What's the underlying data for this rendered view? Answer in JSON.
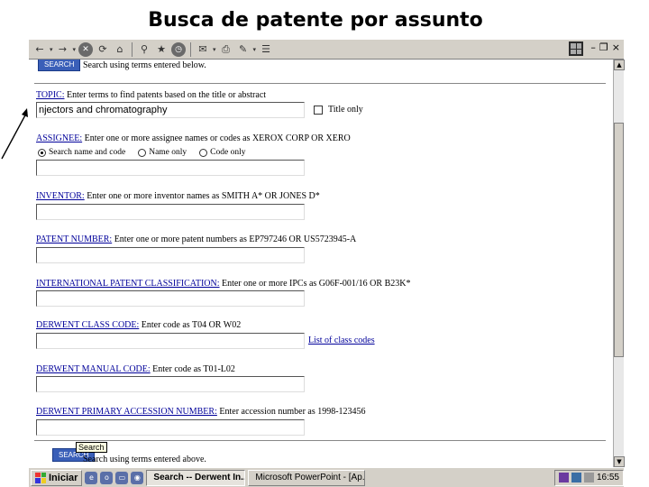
{
  "slide": {
    "title": "Busca de patente por assunto"
  },
  "browser": {
    "toolbar_icons": [
      "back-arrow-icon",
      "forward-arrow-icon",
      "stop-icon",
      "refresh-icon",
      "home-icon",
      "search-icon",
      "favorites-icon",
      "history-icon",
      "mail-icon",
      "print-icon",
      "edit-icon",
      "discuss-icon"
    ],
    "window_controls": {
      "minimize": "–",
      "restore": "❐",
      "close": "×"
    }
  },
  "form": {
    "top_search_button": "SEARCH",
    "top_search_note": "Search using terms entered below.",
    "topic": {
      "label": "TOPIC:",
      "hint": " Enter terms to find patents based on the title or abstract",
      "value": "njectors and chromatography",
      "title_only_label": "Title only"
    },
    "assignee": {
      "label": "ASSIGNEE:",
      "hint": " Enter one or more assignee names or codes as XEROX CORP OR XERO",
      "radios": [
        {
          "label": "Search name and code",
          "checked": true
        },
        {
          "label": "Name only",
          "checked": false
        },
        {
          "label": "Code only",
          "checked": false
        }
      ],
      "value": ""
    },
    "inventor": {
      "label": "INVENTOR:",
      "hint": " Enter one or more inventor names as SMITH A* OR JONES D*",
      "value": ""
    },
    "patent_number": {
      "label": "PATENT NUMBER:",
      "hint": " Enter one or more patent numbers as EP797246 OR US5723945-A",
      "value": ""
    },
    "ipc": {
      "label": "INTERNATIONAL PATENT CLASSIFICATION:",
      "hint": " Enter one or more IPCs as G06F-001/16 OR B23K*",
      "value": ""
    },
    "derwent_class": {
      "label": "DERWENT CLASS CODE:",
      "hint": " Enter code as T04 OR W02",
      "value": "",
      "list_link": "List of class codes"
    },
    "derwent_manual": {
      "label": "DERWENT MANUAL CODE:",
      "hint": " Enter code as T01-L02",
      "value": ""
    },
    "derwent_accession": {
      "label": "DERWENT PRIMARY ACCESSION NUMBER:",
      "hint": " Enter accession number as 1998-123456",
      "value": ""
    },
    "bottom_search_button": "SEARCH",
    "bottom_search_note": "Search using terms entered above.",
    "tooltip": "Search"
  },
  "taskbar": {
    "start_label": "Iniciar",
    "quick_launch": [
      "ie-icon",
      "outlook-icon",
      "desktop-icon",
      "channels-icon"
    ],
    "tasks": [
      {
        "label": "Search -- Derwent In...",
        "active": true
      },
      {
        "label": "Microsoft PowerPoint - [Ap...",
        "active": false
      }
    ],
    "clock": "16:55"
  },
  "colors": {
    "link": "#00009a",
    "search_button": "#3a5fb8",
    "chrome": "#d4d0c8"
  }
}
